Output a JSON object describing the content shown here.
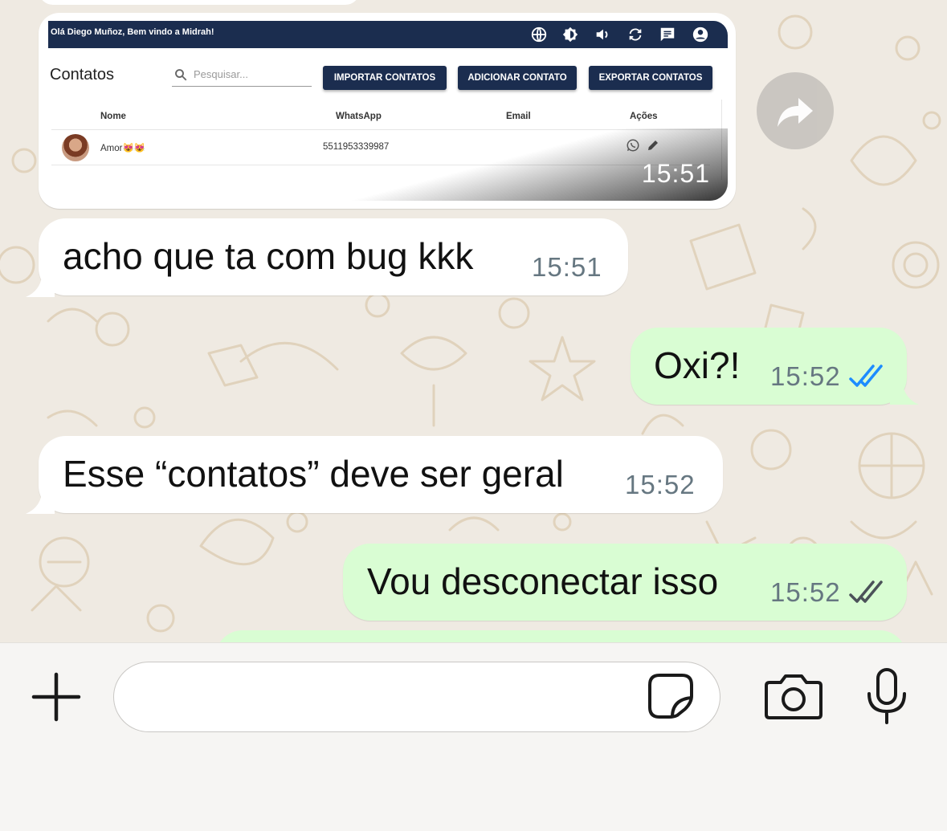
{
  "colors": {
    "chat_bg": "#efeae2",
    "incoming": "#ffffff",
    "outgoing": "#d9fdd3",
    "read_tick": "#1d8cff",
    "delivered_tick": "#667781",
    "app_navy": "#1b2d4f"
  },
  "image_message": {
    "screenshot": {
      "greeting": "Olá Diego Muñoz, Bem vindo a Midrah!",
      "toolbar_icons": [
        "globe-icon",
        "brightness-icon",
        "volume-icon",
        "sync-icon",
        "chat-icon",
        "account-icon"
      ],
      "page_title": "Contatos",
      "search_placeholder": "Pesquisar...",
      "buttons": {
        "import": "IMPORTAR CONTATOS",
        "add": "ADICIONAR CONTATO",
        "export": "EXPORTAR CONTATOS"
      },
      "columns": [
        "Nome",
        "WhatsApp",
        "Email",
        "Ações"
      ],
      "rows": [
        {
          "name": "Amor😻😻",
          "whatsapp": "5511953339987",
          "email": ""
        }
      ]
    },
    "time": "15:51"
  },
  "messages": [
    {
      "direction": "in",
      "text": "acho que ta com bug kkk",
      "time": "15:51"
    },
    {
      "direction": "out",
      "text": "Oxi?!",
      "time": "15:52",
      "status": "read"
    },
    {
      "direction": "in",
      "text": "Esse “contatos” deve ser geral",
      "time": "15:52"
    },
    {
      "direction": "out",
      "text": "Vou desconectar isso",
      "time": "15:52",
      "status": "delivered"
    }
  ],
  "composer": {
    "input_value": "",
    "icons": [
      "plus-icon",
      "sticker-icon",
      "camera-icon",
      "microphone-icon"
    ]
  }
}
